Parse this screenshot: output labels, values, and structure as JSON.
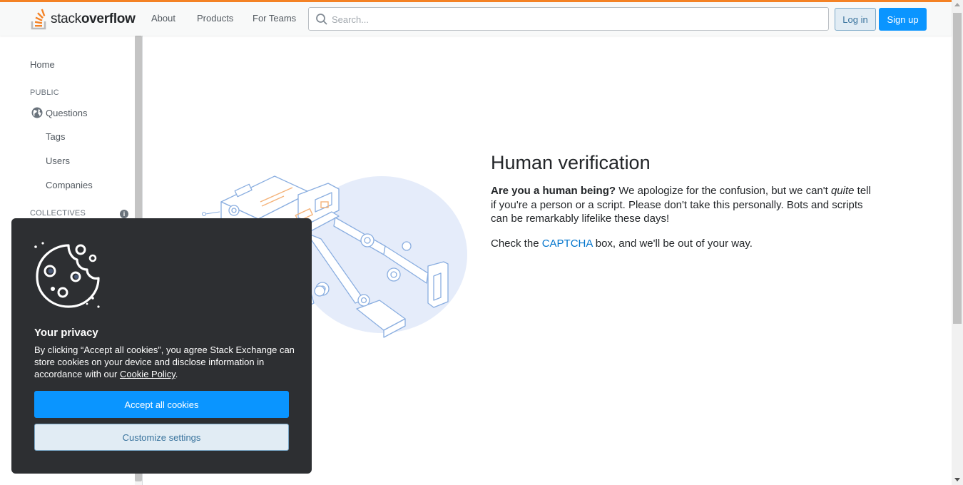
{
  "header": {
    "logo_text_light": "stack",
    "logo_text_bold": "overflow",
    "nav": [
      "About",
      "Products",
      "For Teams"
    ],
    "search_placeholder": "Search...",
    "login_label": "Log in",
    "signup_label": "Sign up",
    "accent_color": "#f48225"
  },
  "sidebar": {
    "home": "Home",
    "public_heading": "PUBLIC",
    "items": [
      "Questions",
      "Tags",
      "Users",
      "Companies"
    ],
    "collectives_heading": "COLLECTIVES",
    "info_icon": "i"
  },
  "main": {
    "title": "Human verification",
    "para1_bold": "Are you a human being?",
    "para1_before_em": " We apologize for the confusion, but we can't ",
    "para1_em": "quite",
    "para1_after_em": " tell if you're a person or a script. Please don't take this personally. Bots and scripts can be remarkably lifelike these days!",
    "para2_before": "Check the ",
    "para2_link": "CAPTCHA",
    "para2_after": " box, and we'll be out of your way.",
    "illustration_icon": "robot-verify-illustration"
  },
  "cookie_banner": {
    "title": "Your privacy",
    "text_before": "By clicking “Accept all cookies”, you agree Stack Exchange can store cookies on your device and disclose information in accordance with our ",
    "link": "Cookie Policy",
    "text_after": ".",
    "accept_label": "Accept all cookies",
    "customize_label": "Customize settings",
    "icon": "cookie-icon"
  }
}
